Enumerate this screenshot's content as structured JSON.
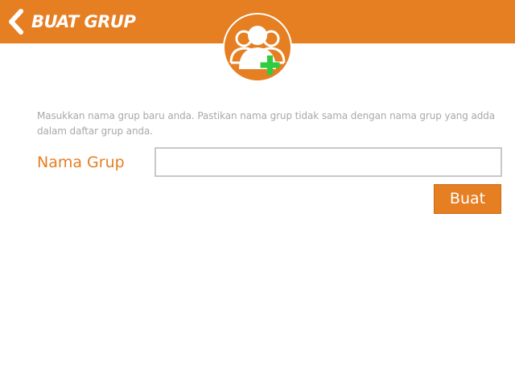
{
  "header": {
    "title": "BUAT GRUP",
    "back_icon": "chevron-left-icon",
    "background_color": "#e67e22"
  },
  "emblem": {
    "icon": "group-add-icon",
    "plus_color": "#2ecc40"
  },
  "form": {
    "instruction": "Masukkan nama grup baru anda. Pastikan nama grup tidak sama dengan nama grup yang adda dalam daftar grup anda.",
    "name_label": "Nama Grup",
    "name_value": "",
    "name_placeholder": "",
    "submit_label": "Buat"
  }
}
